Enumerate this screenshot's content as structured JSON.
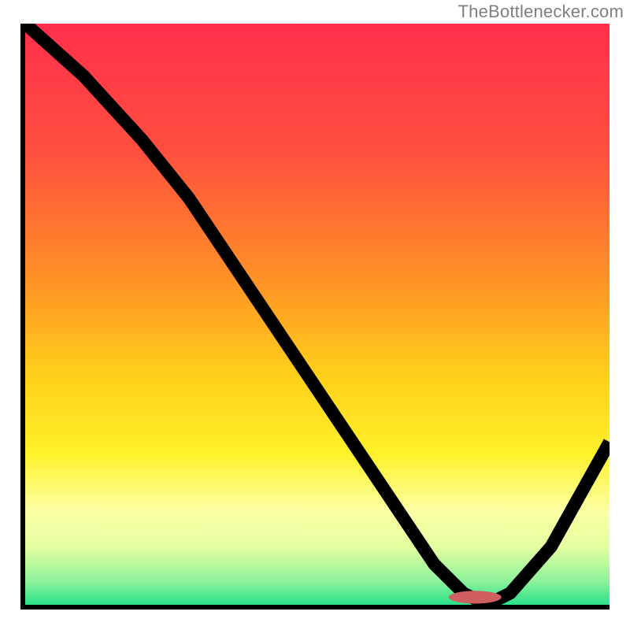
{
  "caption": {
    "text": "TheBottlenecker.com"
  },
  "chart_data": {
    "type": "line",
    "title": "",
    "xlabel": "",
    "ylabel": "",
    "xlim": [
      0,
      100
    ],
    "ylim": [
      0,
      100
    ],
    "grid": false,
    "legend": false,
    "gradient_stops": [
      {
        "offset": 0,
        "color": "#ff2f4c"
      },
      {
        "offset": 22,
        "color": "#ff4f3f"
      },
      {
        "offset": 42,
        "color": "#ff8b28"
      },
      {
        "offset": 60,
        "color": "#ffce1a"
      },
      {
        "offset": 74,
        "color": "#fff12a"
      },
      {
        "offset": 84,
        "color": "#fbffa5"
      },
      {
        "offset": 90,
        "color": "#e4ffa0"
      },
      {
        "offset": 96,
        "color": "#8cf29a"
      },
      {
        "offset": 100,
        "color": "#29e089"
      }
    ],
    "series": [
      {
        "name": "bottleneck-curve",
        "x": [
          0,
          10,
          20,
          28,
          40,
          52,
          62,
          70,
          75,
          79,
          83,
          90,
          100
        ],
        "y": [
          100,
          91,
          80,
          70,
          52,
          34,
          19,
          7,
          2,
          0,
          2,
          10,
          28
        ]
      }
    ],
    "marker": {
      "x": 77,
      "y": 1.3,
      "rx": 4.5,
      "ry": 1.1,
      "color": "#d05f62"
    }
  }
}
